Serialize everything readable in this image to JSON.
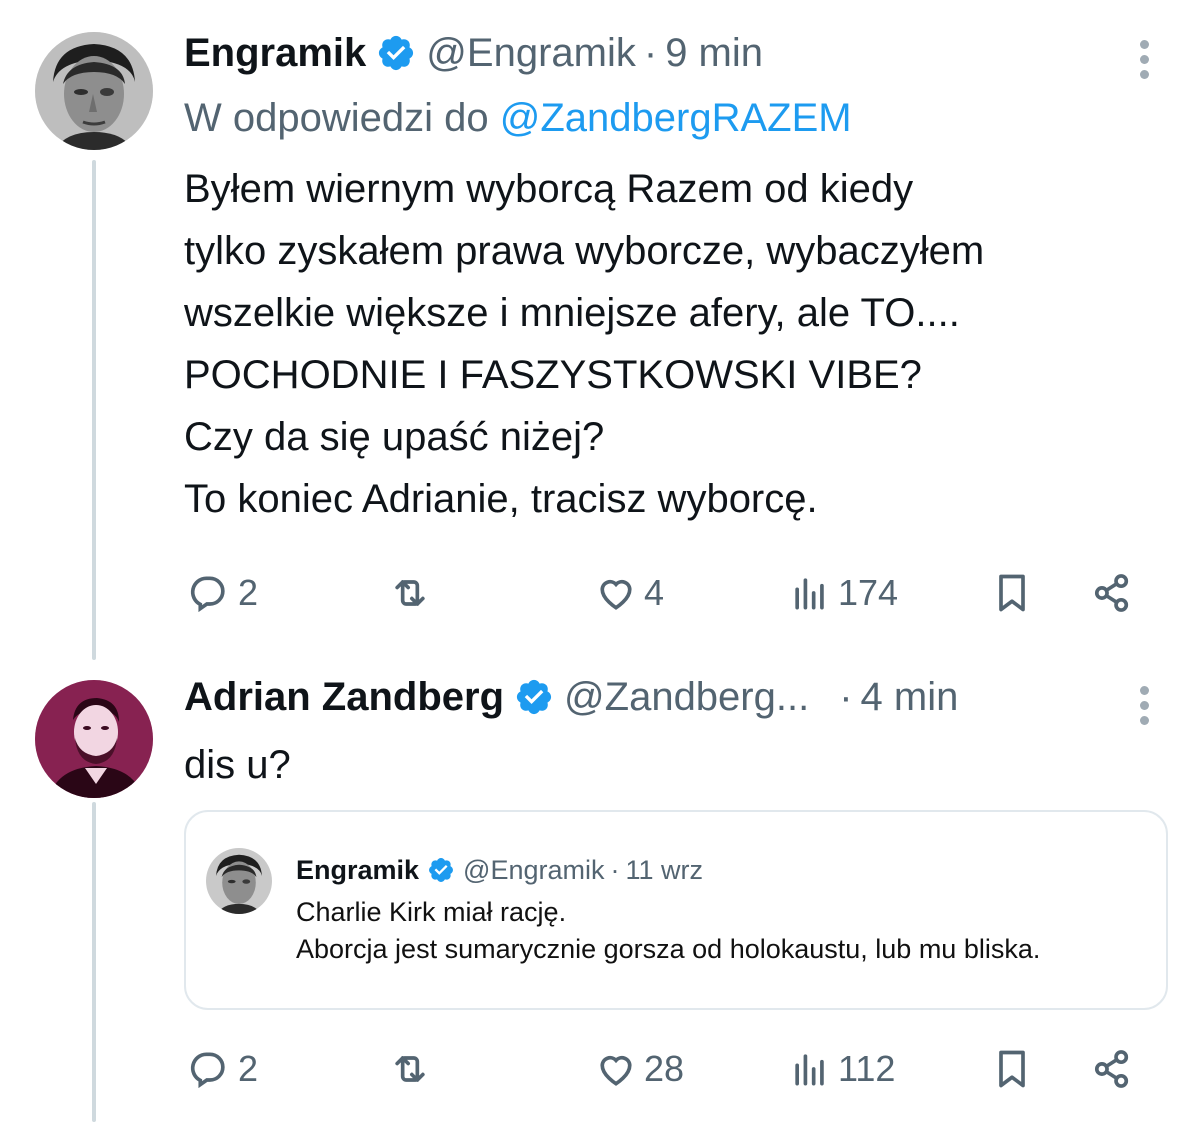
{
  "tweet1": {
    "author": {
      "name": "Engramik",
      "handle": "@Engramik",
      "time": "9 min",
      "separator": "·"
    },
    "reply_to": {
      "prefix": "W odpowiedzi do",
      "mention": "@ZandbergRAZEM"
    },
    "text": "Byłem wiernym wyborcą Razem od kiedy\ntylko zyskałem prawa wyborcze, wybaczyłem\nwszelkie większe i mniejsze afery, ale TO....\nPOCHODNIE I FASZYSTKOWSKI VIBE?\nCzy da się upaść niżej?\nTo koniec Adrianie, tracisz wyborcę.",
    "actions": {
      "replies": "2",
      "retweets": "",
      "likes": "4",
      "views": "174"
    }
  },
  "tweet2": {
    "author": {
      "name": "Adrian Zandberg",
      "handle": "@Zandberg...",
      "time": "4 min",
      "separator": "·"
    },
    "text": "dis u?",
    "quote": {
      "name": "Engramik",
      "handle": "@Engramik",
      "separator": "·",
      "time": "11 wrz",
      "text": "Charlie Kirk miał rację.\nAborcja jest sumarycznie gorsza od holokaustu, lub mu bliska."
    },
    "actions": {
      "replies": "2",
      "retweets": "",
      "likes": "28",
      "views": "112"
    }
  },
  "colors": {
    "text": "#0f1419",
    "secondary": "#536471",
    "accent": "#1d9bf0",
    "thread_line": "#cfd9de",
    "zandberg_avatar_bg": "#7d1c4a"
  },
  "icons": [
    "verified-badge-icon",
    "more-icon",
    "reply-icon",
    "retweet-icon",
    "like-icon",
    "views-icon",
    "bookmark-icon",
    "share-icon"
  ]
}
